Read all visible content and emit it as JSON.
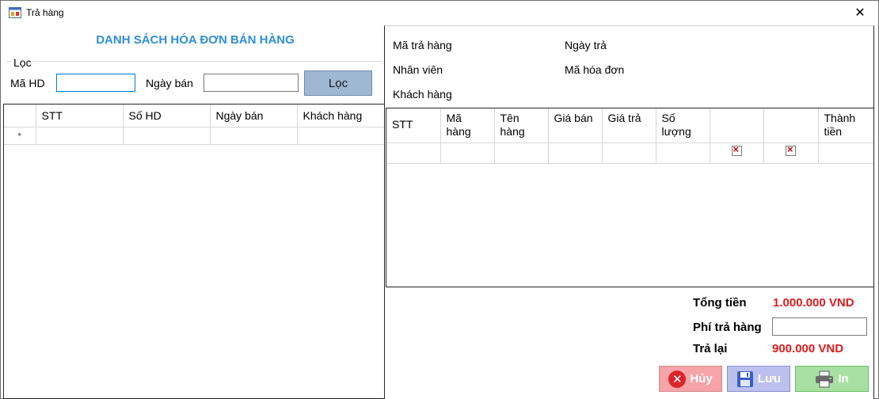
{
  "window": {
    "title": "Trả hàng",
    "close_glyph": "✕"
  },
  "left": {
    "heading": "DANH SÁCH HÓA ĐƠN BÁN HÀNG",
    "filter_group": "Lọc",
    "ma_hd_label": "Mã HD",
    "ma_hd_value": "",
    "ngay_ban_label": "Ngày bán",
    "ngay_ban_value": "",
    "loc_button": "Lọc",
    "columns": [
      "STT",
      "Số HD",
      "Ngày bán",
      "Khách hàng"
    ],
    "new_row_marker": "*"
  },
  "right": {
    "ma_tra_hang_label": "Mã trả hàng",
    "ngay_tra_label": "Ngày trả",
    "nhan_vien_label": "Nhân viên",
    "ma_hoa_don_label": "Mã hóa đơn",
    "khach_hang_label": "Khách hàng",
    "columns": [
      "STT",
      "Mã hàng",
      "Tên hàng",
      "Giá bán",
      "Giá trả",
      "Số lượng",
      "",
      "",
      "Thành tiền"
    ],
    "summary": {
      "tong_tien_label": "Tổng tiền",
      "tong_tien_value": "1.000.000 VND",
      "phi_tra_hang_label": "Phí trả hàng",
      "phi_tra_hang_value": "",
      "tra_lai_label": "Trả lại",
      "tra_lai_value": "900.000 VND"
    },
    "buttons": {
      "huy": "Hủy",
      "luu": "Lưu",
      "in": "In"
    }
  },
  "colors": {
    "heading": "#2f8fd8",
    "money": "#e01b1b",
    "loc_button": "#9fb7d3",
    "huy_button": "#f6a4a7",
    "luu_button": "#bcc0ee",
    "in_button": "#a7e0a2"
  }
}
